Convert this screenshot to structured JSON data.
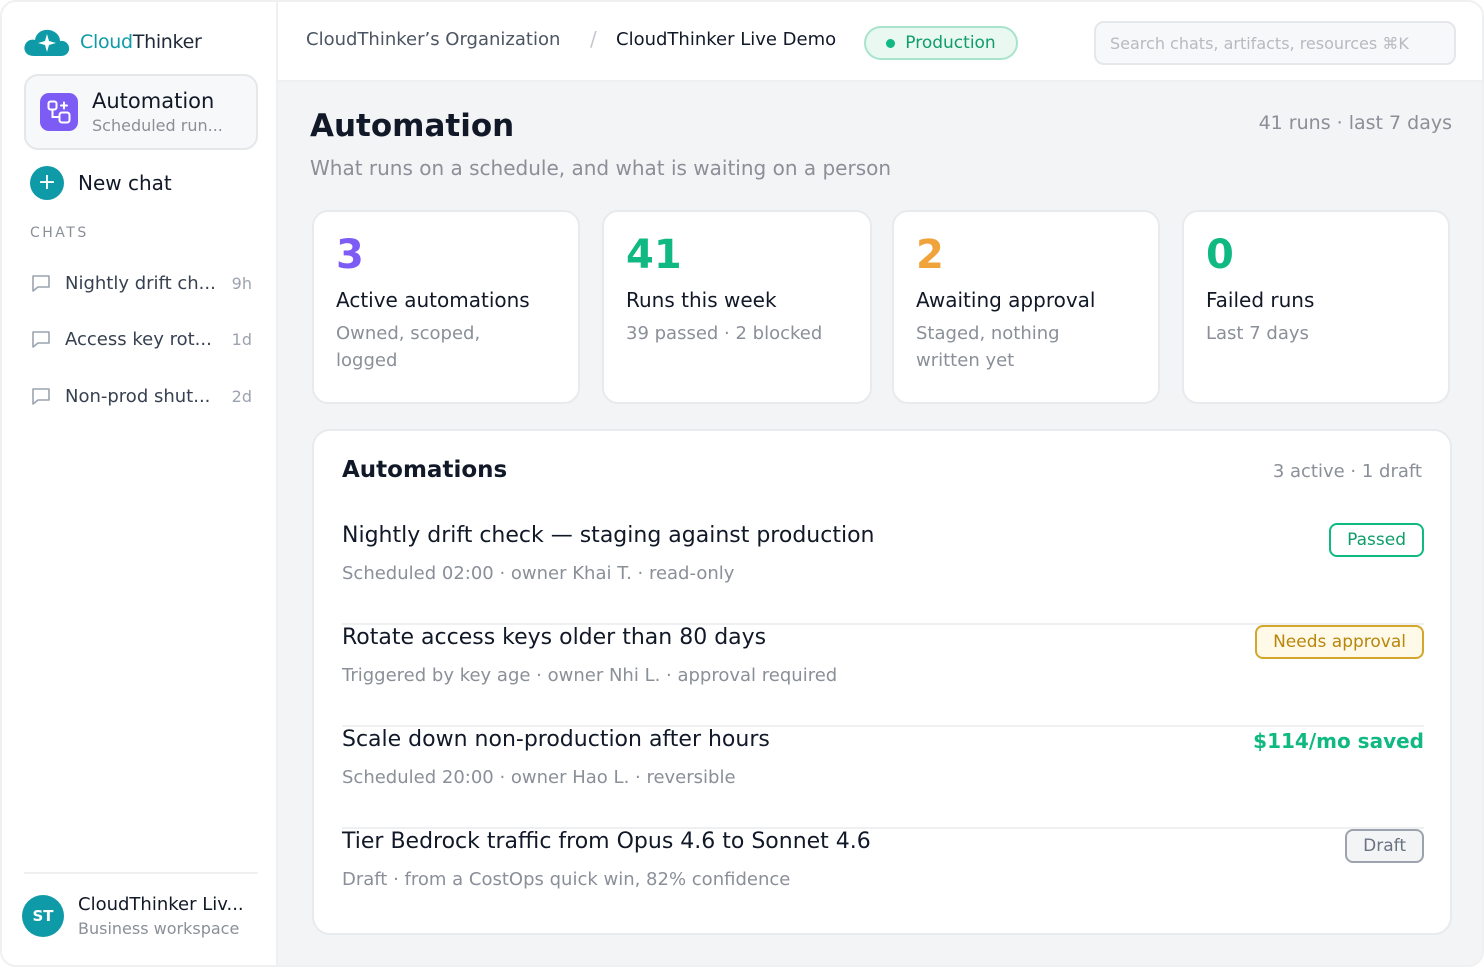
{
  "brand": {
    "name_part1": "Cloud",
    "name_part2": "Thinker",
    "accent": "#0e9aa7"
  },
  "sidebar": {
    "active_nav": {
      "title": "Automation",
      "subtitle": "Scheduled run...",
      "icon": "automation-icon"
    },
    "new_chat_label": "New chat",
    "chats_label": "CHATS",
    "chats": [
      {
        "title": "Nightly drift ch...",
        "time": "9h"
      },
      {
        "title": "Access key rot...",
        "time": "1d"
      },
      {
        "title": "Non-prod shut...",
        "time": "2d"
      }
    ],
    "workspace": {
      "initials": "ST",
      "name": "CloudThinker Liv...",
      "subtitle": "Business workspace"
    }
  },
  "topbar": {
    "org": "CloudThinker’s Organization",
    "separator": "/",
    "project": "CloudThinker Live Demo",
    "environment": "Production",
    "search_placeholder": "Search chats, artifacts, resources ⌘K"
  },
  "page": {
    "title": "Automation",
    "subtitle": "What runs on a schedule, and what is waiting on a person",
    "meta": "41 runs · last 7 days"
  },
  "stats": [
    {
      "value": "3",
      "label": "Active automations",
      "desc": "Owned, scoped, logged",
      "color": "#7c5cf5"
    },
    {
      "value": "41",
      "label": "Runs this week",
      "desc": "39 passed · 2 blocked",
      "color": "#10b981"
    },
    {
      "value": "2",
      "label": "Awaiting approval",
      "desc": "Staged, nothing written yet",
      "color": "#f0a23b"
    },
    {
      "value": "0",
      "label": "Failed runs",
      "desc": "Last 7 days",
      "color": "#10b981"
    }
  ],
  "automations": {
    "title": "Automations",
    "meta": "3 active · 1 draft",
    "items": [
      {
        "title": "Nightly drift check — staging against production",
        "subtitle": "Scheduled 02:00 · owner Khai T. · read-only",
        "status": "Passed"
      },
      {
        "title": "Rotate access keys older than 80 days",
        "subtitle": "Triggered by key age · owner Nhi L. · approval required",
        "status": "Needs approval"
      },
      {
        "title": "Scale down non-production after hours",
        "subtitle": "Scheduled 20:00 · owner Hao L. · reversible",
        "status": "$114/mo saved"
      },
      {
        "title": "Tier Bedrock traffic from Opus 4.6 to Sonnet 4.6",
        "subtitle": "Draft · from a CostOps quick win, 82% confidence",
        "status": "Draft"
      }
    ]
  }
}
